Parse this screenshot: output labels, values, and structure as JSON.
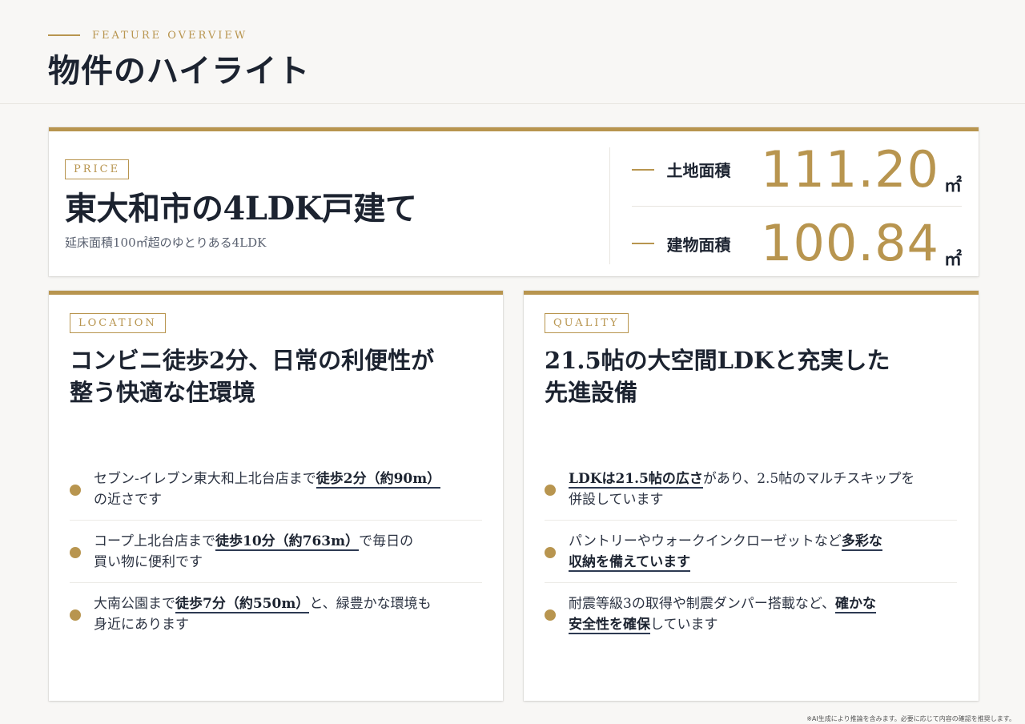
{
  "header": {
    "eyebrow": "FEATURE OVERVIEW",
    "title": "物件のハイライト"
  },
  "price_card": {
    "tag": "PRICE",
    "title": "東大和市の4LDK戸建て",
    "subtitle": "延床面積100㎡超のゆとりある4LDK",
    "stats": [
      {
        "label": "土地面積",
        "value": "111.20",
        "unit": "㎡"
      },
      {
        "label": "建物面積",
        "value": "100.84",
        "unit": "㎡"
      }
    ]
  },
  "location_card": {
    "tag": "LOCATION",
    "title_line1": "コンビニ徒歩2分、日常の利便性が",
    "title_line2": "整う快適な住環境",
    "items": [
      {
        "pre": "セブン-イレブン東大和上北台店まで",
        "highlight": "徒歩2分（約90m）",
        "line2": "の近さです"
      },
      {
        "pre": "コープ上北台店まで",
        "highlight": "徒歩10分（約763m）",
        "post": "で毎日の",
        "line2": "買い物に便利です"
      },
      {
        "pre": "大南公園まで",
        "highlight": "徒歩7分（約550m）",
        "post": "と、緑豊かな環境も",
        "line2": "身近にあります"
      }
    ]
  },
  "quality_card": {
    "tag": "QUALITY",
    "title_line1": "21.5帖の大空間LDKと充実した",
    "title_line2": "先進設備",
    "items": [
      {
        "highlight": "LDKは21.5帖の広さ",
        "post": "があり、2.5帖のマルチスキップを",
        "line2": "併設しています"
      },
      {
        "pre": "パントリーやウォークインクローゼットなど",
        "highlight": "多彩な",
        "highlight2": "収納を備えています"
      },
      {
        "pre": "耐震等級3の取得や制震ダンパー搭載など、",
        "highlight": "確かな",
        "highlight2": "安全性を確保",
        "post2": "しています"
      }
    ]
  },
  "footnote": "※AI生成により推論を含みます。必要に応じて内容の確認を推奨します。",
  "colors": {
    "accent": "#b8954f",
    "text": "#1c2330",
    "background": "#f8f7f5"
  }
}
